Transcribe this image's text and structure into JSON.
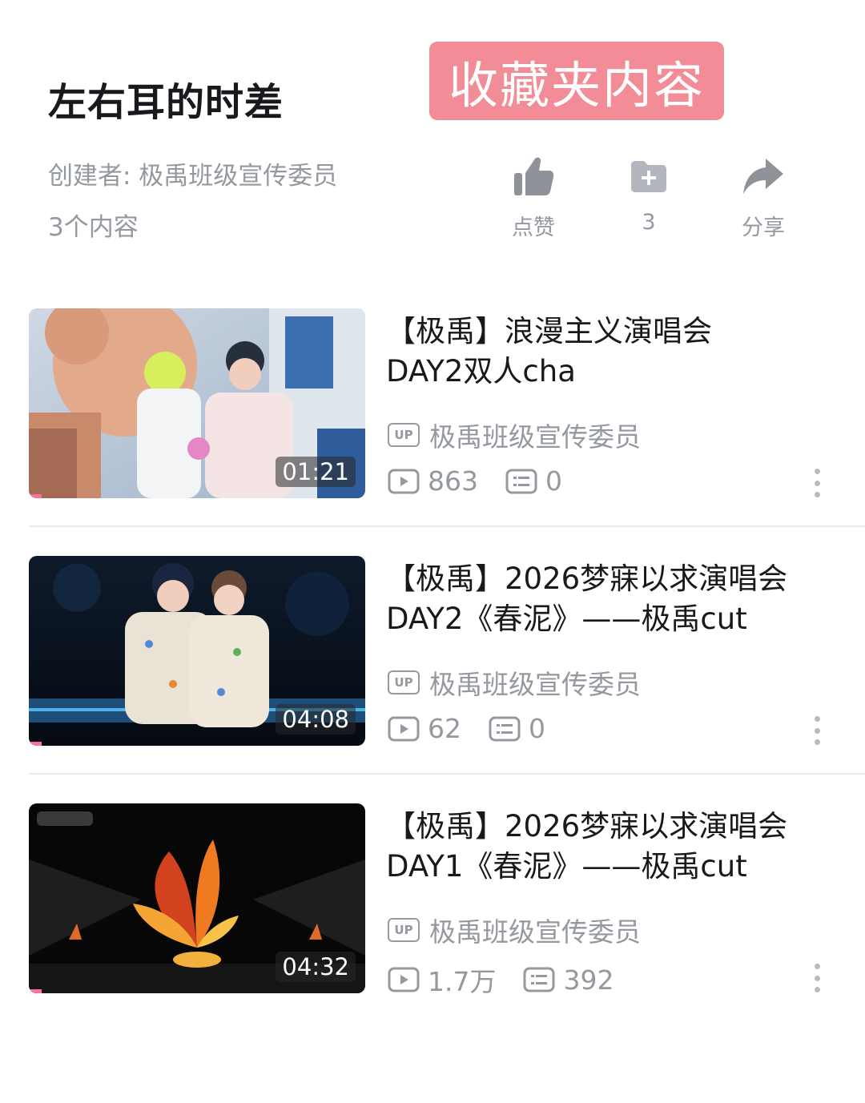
{
  "collection": {
    "title": "左右耳的时差",
    "creator": "创建者: 极禹班级宣传委员",
    "item_count": "3个内容"
  },
  "overlay_badge": "收藏夹内容",
  "actions": {
    "like": {
      "icon": "thumbs-up-icon",
      "label": "点赞"
    },
    "favorite": {
      "icon": "folder-add-icon",
      "label": "3"
    },
    "share": {
      "icon": "share-arrow-icon",
      "label": "分享"
    }
  },
  "videos": [
    {
      "title": "【极禹】浪漫主义演唱会\nDAY2双人cha",
      "duration": "01:21",
      "author": "极禹班级宣传委员",
      "up_badge": "UP",
      "views": "863",
      "comments": "0"
    },
    {
      "title": "【极禹】2026梦寐以求演唱会\nDAY2《春泥》——极禹cut",
      "duration": "04:08",
      "author": "极禹班级宣传委员",
      "up_badge": "UP",
      "views": "62",
      "comments": "0"
    },
    {
      "title": "【极禹】2026梦寐以求演唱会\nDAY1《春泥》——极禹cut",
      "duration": "04:32",
      "author": "极禹班级宣传委员",
      "up_badge": "UP",
      "views": "1.7万",
      "comments": "392"
    }
  ],
  "colors": {
    "badge_bg": "#f28c97",
    "muted_text": "#9499a0",
    "accent_pink": "#fb7299"
  }
}
